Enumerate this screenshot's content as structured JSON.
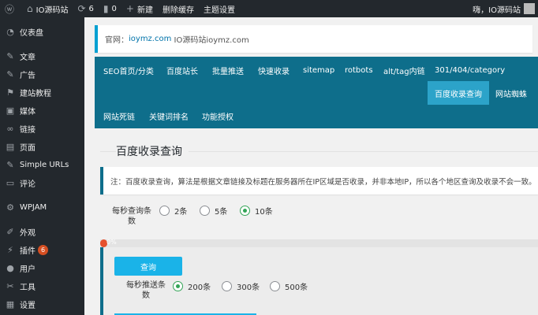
{
  "adminbar": {
    "site_name": "IO源码站",
    "updates_count": "6",
    "comments_count": "0",
    "new_label": "新建",
    "clear_cache_label": "删除缓存",
    "theme_settings_label": "主题设置",
    "greeting": "嗨，IO源码站"
  },
  "sidebar": {
    "items": [
      {
        "label": "仪表盘",
        "icon": "dashboard-icon"
      },
      {
        "label": "文章",
        "icon": "pin-icon"
      },
      {
        "label": "广告",
        "icon": "pin-icon"
      },
      {
        "label": "建站教程",
        "icon": "flag-icon"
      },
      {
        "label": "媒体",
        "icon": "media-icon"
      },
      {
        "label": "链接",
        "icon": "link-icon"
      },
      {
        "label": "页面",
        "icon": "page-icon"
      },
      {
        "label": "Simple URLs",
        "icon": "pin-icon"
      },
      {
        "label": "评论",
        "icon": "comment-icon"
      },
      {
        "label": "WPJAM",
        "icon": "gear-icon"
      },
      {
        "label": "外观",
        "icon": "brush-icon"
      },
      {
        "label": "插件",
        "icon": "plugin-icon",
        "badge": "6"
      },
      {
        "label": "用户",
        "icon": "user-icon"
      },
      {
        "label": "工具",
        "icon": "wrench-icon"
      },
      {
        "label": "设置",
        "icon": "settings-icon"
      }
    ]
  },
  "site_notice": {
    "prefix": "官网：",
    "link_text": "ioymz.com",
    "suffix": " IO源码站ioymz.com"
  },
  "tabs": [
    "SEO首页/分类",
    "百度站长",
    "批量推送",
    "快速收录",
    "sitemap",
    "rotbots",
    "alt/tag内链",
    "301/404/category",
    "百度收录查询",
    "网站蜘蛛",
    "网站死链",
    "关键词排名",
    "功能授权"
  ],
  "active_tab": "百度收录查询",
  "section_title": "百度收录查询",
  "info_text": "注：百度收录查询，算法是根据文章链接及标题在服务器所在IP区域是否收录，并非本地IP，所以各个地区查询及收录不会一致。",
  "query_rate": {
    "label_line1": "每秒查询条",
    "label_line2": "数",
    "options": [
      "2条",
      "5条",
      "10条"
    ],
    "selected": "10条"
  },
  "progress": {
    "text": "0%",
    "percent": 0
  },
  "query_button": "查询",
  "push_rate": {
    "label_line1": "每秒推送条",
    "label_line2": "数",
    "options": [
      "200条",
      "300条",
      "500条"
    ],
    "selected": "200条"
  },
  "colors": {
    "admin_dark": "#23282d",
    "nav_teal": "#0e6e8b",
    "active_tab": "#2ca3c9",
    "query_button": "#1ab3e8",
    "radio_checked": "#33a456",
    "progress": "#e5512e",
    "badge": "#d54e21"
  }
}
